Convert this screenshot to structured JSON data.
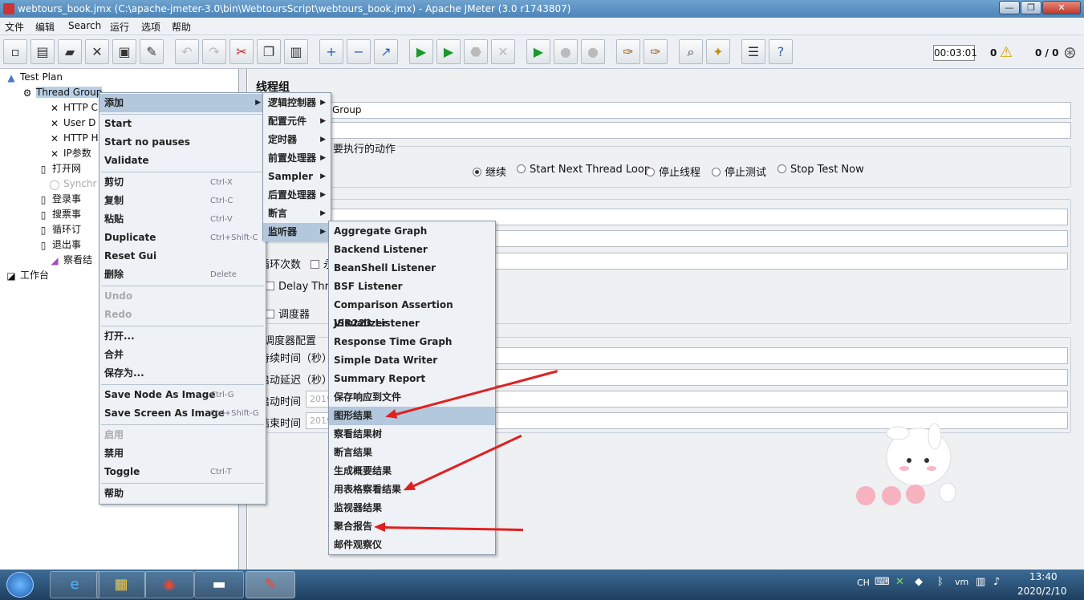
{
  "window": {
    "title": "webtours_book.jmx (C:\\apache-jmeter-3.0\\bin\\WebtoursScript\\webtours_book.jmx) - Apache JMeter (3.0 r1743807)",
    "min": "—",
    "max": "❐",
    "close": "✕"
  },
  "menubar": [
    "文件",
    "编辑",
    "Search",
    "运行",
    "选项",
    "帮助"
  ],
  "status": {
    "timer": "00:03:01",
    "warnings": "0",
    "threads": "0 / 0"
  },
  "tree": {
    "test_plan": "Test Plan",
    "thread_group": "Thread Group",
    "items": [
      "HTTP C",
      "User D",
      "HTTP H",
      "IP参数",
      "打开网",
      "Synchr",
      "登录事",
      "搜票事",
      "循环订",
      "退出事",
      "察看结"
    ],
    "workbench": "工作台"
  },
  "right": {
    "section_title": "线程组",
    "name_value": "Group",
    "action_label": "要执行的动作",
    "radios": [
      "继续",
      "Start Next Thread Loop",
      "停止线程",
      "停止测试",
      "Stop Test Now"
    ],
    "loop_label": "循环次数",
    "loop_forever": "永",
    "delay_label": "Delay Threa",
    "scheduler_label": "调度器",
    "scheduler_conf": "调度器配置",
    "duration": "持续时间（秒）",
    "startup_delay": "启动延迟（秒）",
    "start_time": "启动时间",
    "end_time": "结束时间",
    "time_value_start": "2019",
    "time_value_end": "2019"
  },
  "context_menu": [
    {
      "label": "添加",
      "acc": "",
      "arrow": true,
      "hl": true
    },
    {
      "label": "Start",
      "acc": ""
    },
    {
      "label": "Start no pauses",
      "acc": ""
    },
    {
      "label": "Validate",
      "acc": ""
    },
    {
      "label": "剪切",
      "acc": "Ctrl-X"
    },
    {
      "label": "复制",
      "acc": "Ctrl-C"
    },
    {
      "label": "粘贴",
      "acc": "Ctrl-V"
    },
    {
      "label": "Duplicate",
      "acc": "Ctrl+Shift-C"
    },
    {
      "label": "Reset Gui",
      "acc": ""
    },
    {
      "label": "删除",
      "acc": "Delete"
    },
    {
      "label": "Undo",
      "acc": "",
      "dis": true
    },
    {
      "label": "Redo",
      "acc": "",
      "dis": true
    },
    {
      "label": "打开...",
      "acc": ""
    },
    {
      "label": "合并",
      "acc": ""
    },
    {
      "label": "保存为...",
      "acc": ""
    },
    {
      "label": "Save Node As Image",
      "acc": "Ctrl-G"
    },
    {
      "label": "Save Screen As Image",
      "acc": "Ctrl+Shift-G"
    },
    {
      "label": "启用",
      "acc": "",
      "dis": true
    },
    {
      "label": "禁用",
      "acc": ""
    },
    {
      "label": "Toggle",
      "acc": "Ctrl-T"
    },
    {
      "label": "帮助",
      "acc": ""
    }
  ],
  "add_submenu": [
    "逻辑控制器",
    "配置元件",
    "定时器",
    "前置处理器",
    "Sampler",
    "后置处理器",
    "断言",
    "监听器"
  ],
  "listener_submenu": [
    "Aggregate Graph",
    "Backend Listener",
    "BeanShell Listener",
    "BSF Listener",
    "Comparison Assertion Visualizer",
    "JSR223 Listener",
    "Response Time Graph",
    "Simple Data Writer",
    "Summary Report",
    "保存响应到文件",
    "图形结果",
    "察看结果树",
    "断言结果",
    "生成概要结果",
    "用表格察看结果",
    "监视器结果",
    "聚合报告",
    "邮件观察仪"
  ],
  "taskbar": {
    "lang": "CH",
    "time": "13:40",
    "date": "2020/2/10"
  },
  "colors": {
    "highlight": "#b3c7dd",
    "arrow": "#e02020",
    "titlebar": "#4d84b8"
  }
}
